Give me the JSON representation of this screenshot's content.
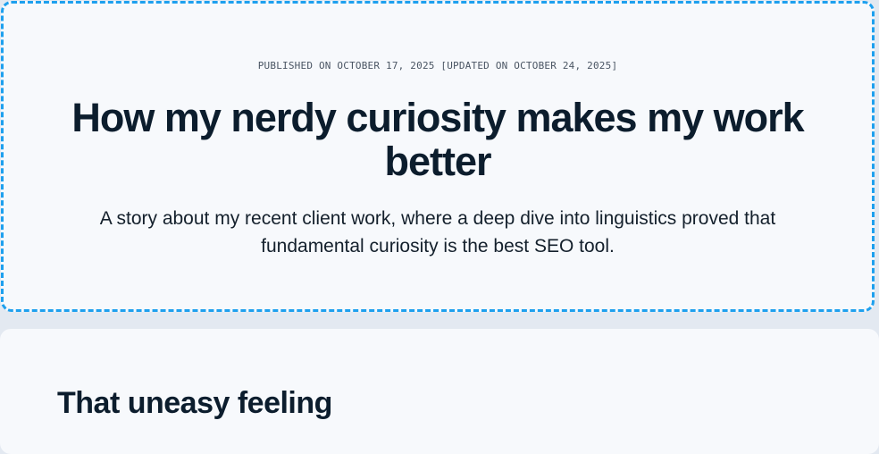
{
  "article": {
    "published": "PUBLISHED ON OCTOBER 17, 2025 [UPDATED ON OCTOBER 24, 2025]",
    "title": "How my nerdy curiosity makes my work better",
    "lede": "A story about my recent client work, where a deep dive into linguistics proved that fundamental curiosity is the best SEO tool."
  },
  "content": {
    "heading": "That uneasy feeling"
  },
  "colors": {
    "accent_border": "#1ea0ee",
    "card_bg": "#f7f9fc",
    "page_bg": "#e3e9f1",
    "heading_text": "#0c1d2d"
  }
}
